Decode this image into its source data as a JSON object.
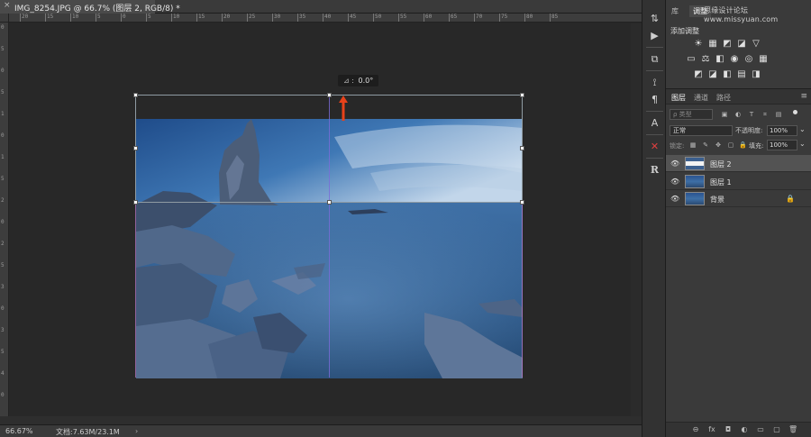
{
  "document": {
    "tab_title": "IMG_8254.JPG @ 66.7% (图层 2, RGB/8) *",
    "close_glyph": "×"
  },
  "rulers": {
    "top_ticks": [
      "20",
      "15",
      "10",
      "5",
      "0",
      "5",
      "10",
      "15",
      "20",
      "25",
      "30",
      "35",
      "40",
      "45",
      "50",
      "55",
      "60",
      "65",
      "70",
      "75",
      "80",
      "85"
    ],
    "left_ticks": [
      "0",
      "5",
      "0",
      "5",
      "1",
      "0",
      "1",
      "5",
      "2",
      "0",
      "2",
      "5",
      "3",
      "0",
      "3",
      "5",
      "4",
      "0"
    ]
  },
  "canvas": {
    "rotation_readout": "0.0°",
    "rotation_prefix": "⊿ :",
    "arrow_color": "#e8421a"
  },
  "statusbar": {
    "zoom": "66.67%",
    "doc_info": "文档:7.63M/23.1M",
    "arrow": "›"
  },
  "panels": {
    "top_tabs": [
      "库",
      "调整"
    ],
    "watermark": "思缘设计论坛 www.missyuan.com",
    "adjustments_title": "添加调整",
    "adjust_row1": [
      "☀",
      "▦",
      "◩",
      "◪",
      "▽"
    ],
    "adjust_row2": [
      "▭",
      "⚖",
      "◧",
      "◉",
      "◎",
      "▦"
    ],
    "adjust_row3": [
      "◩",
      "◪",
      "◧",
      "▤",
      "◨"
    ]
  },
  "layers_panel": {
    "tabs": [
      "图层",
      "通道",
      "路径"
    ],
    "menu_glyph": "≡",
    "filter_placeholder": "ρ 类型",
    "blend_mode": "正常",
    "opacity_label": "不透明度:",
    "opacity_value": "100%",
    "lock_label": "锁定:",
    "fill_label": "填充:",
    "fill_value": "100%",
    "layers": [
      {
        "name": "图层 2",
        "selected": true,
        "locked": false
      },
      {
        "name": "图层 1",
        "selected": false,
        "locked": false
      },
      {
        "name": "背景",
        "selected": false,
        "locked": true
      }
    ],
    "bottom_icons": [
      "⊖",
      "fx",
      "◘",
      "◐",
      "▭",
      "▢",
      "🗑"
    ]
  },
  "toolstrip": {
    "tools": [
      "⇅",
      "▶",
      "⧉",
      "⟟",
      "¶",
      "A",
      "✕",
      "R"
    ]
  }
}
